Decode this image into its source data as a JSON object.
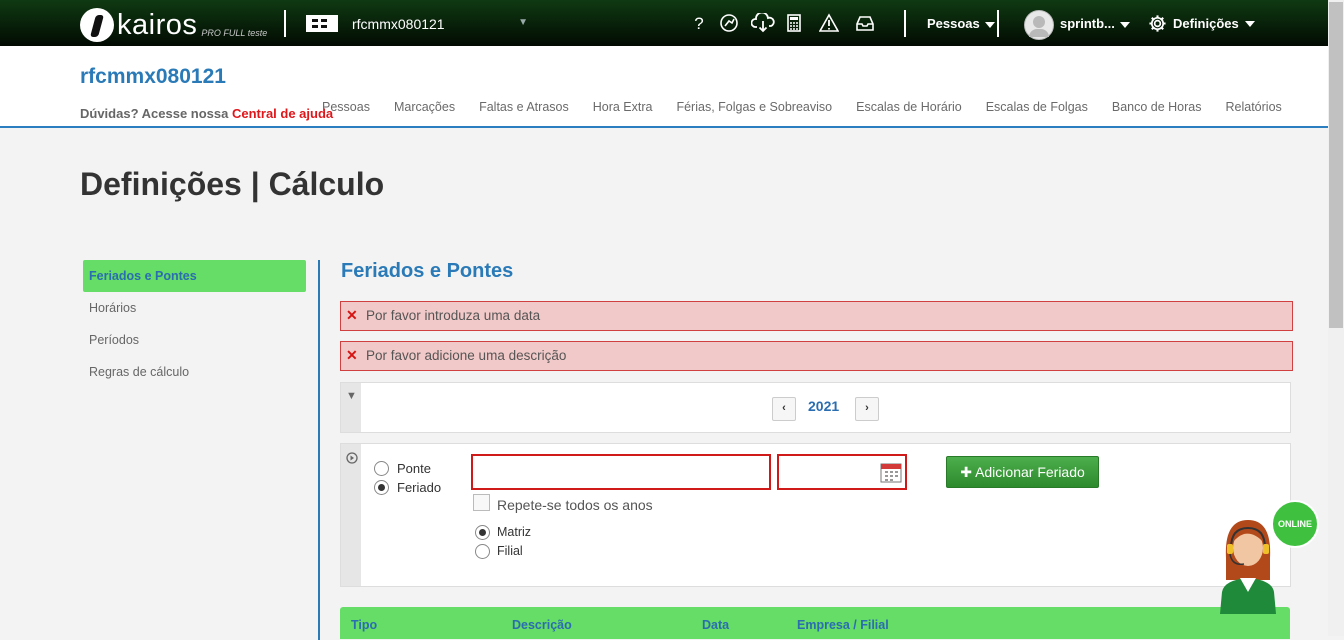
{
  "topbar": {
    "logo_text": "kairos",
    "logo_sub": "PRO FULL teste",
    "company": "rfcmmx080121",
    "icons": [
      "help-icon",
      "chat-support-icon",
      "cloud-download-icon",
      "calculator-icon",
      "warning-icon",
      "inbox-icon"
    ],
    "help_glyph": "?",
    "pessoas_label": "Pessoas",
    "user_label": "sprintb...",
    "settings_label": "Definições"
  },
  "header": {
    "org_title": "rfcmmx080121",
    "help_prefix": "Dúvidas? Acesse nossa",
    "help_link": "Central de ajuda",
    "nav": [
      "Pessoas",
      "Marcações",
      "Faltas e Atrasos",
      "Hora Extra",
      "Férias, Folgas e Sobreaviso",
      "Escalas de Horário",
      "Escalas de Folgas",
      "Banco de Horas",
      "Relatórios"
    ]
  },
  "page": {
    "title": "Definições | Cálculo"
  },
  "sidebar": {
    "items": [
      {
        "label": "Feriados e Pontes",
        "active": true
      },
      {
        "label": "Horários",
        "active": false
      },
      {
        "label": "Períodos",
        "active": false
      },
      {
        "label": "Regras de cálculo",
        "active": false
      }
    ]
  },
  "content": {
    "section_title": "Feriados e Pontes",
    "alerts": [
      "Por favor introduza uma data",
      "Por favor adicione uma descrição"
    ],
    "year": "2021",
    "prev_glyph": "‹",
    "next_glyph": "›",
    "form": {
      "type_options": [
        {
          "label": "Ponte",
          "selected": false
        },
        {
          "label": "Feriado",
          "selected": true
        }
      ],
      "description_value": "",
      "date_value": "",
      "repeat_label": "Repete-se todos os anos",
      "repeat_checked": false,
      "scope_options": [
        {
          "label": "Matriz",
          "selected": true
        },
        {
          "label": "Filial",
          "selected": false
        }
      ],
      "add_button": "Adicionar Feriado"
    },
    "table": {
      "columns": [
        "Tipo",
        "Descrição",
        "Data",
        "Empresa / Filial"
      ]
    }
  },
  "chat_widget": {
    "badge": "ONLINE"
  },
  "colors": {
    "brand_blue": "#2a7ab8",
    "active_green": "#66dd66",
    "error_red": "#d01a1a",
    "button_green": "#3a9c3a"
  }
}
